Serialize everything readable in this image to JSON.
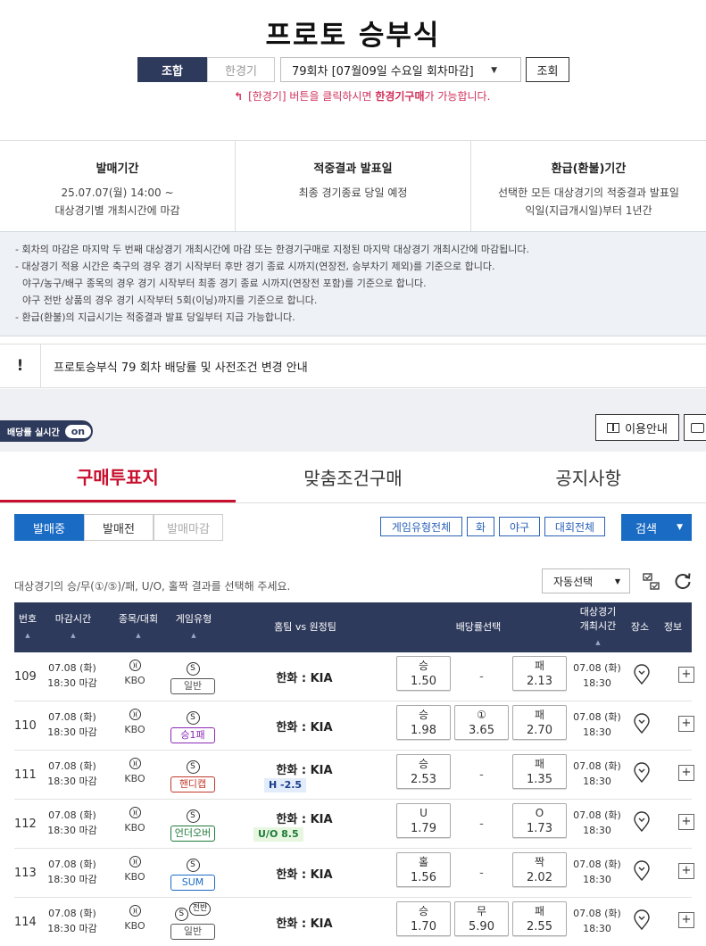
{
  "page": {
    "title": "프로토 승부식",
    "toggle_combo": "조합",
    "toggle_single": "한경기",
    "round_select": "79회차 [07월09일 수요일 회차마감]",
    "lookup": "조회",
    "notice_prefix": "[한경기] 버튼을 클릭하시면 ",
    "notice_bold": "한경기구매",
    "notice_suffix": "가 가능합니다."
  },
  "info": [
    {
      "heading": "발매기간",
      "lines": [
        "25.07.07(월) 14:00 ~",
        "대상경기별 개최시간에 마감"
      ]
    },
    {
      "heading": "적중결과 발표일",
      "lines": [
        "최종 경기종료 당일 예정"
      ]
    },
    {
      "heading": "환급(환불)기간",
      "lines": [
        "선택한 모든 대상경기의 적중결과 발표일",
        "익일(지급개시일)부터 1년간"
      ]
    }
  ],
  "notes": [
    "- 회차의 마감은 마지막 두 번째 대상경기 개최시간에 마감 또는 한경기구매로 지정된 마지막 대상경기 개최시간에 마감됩니다.",
    "- 대상경기 적용 시간은 축구의 경우 경기 시작부터 후반 경기 종료 시까지(연장전, 승부차기 제외)를 기준으로 합니다.",
    "야구/농구/배구 종목의 경우 경기 시작부터 최종 경기 종료 시까지(연장전 포함)를 기준으로 합니다.",
    "야구 전반 상품의 경우 경기 시작부터 5회(이닝)까지를 기준으로 합니다.",
    "- 환급(환불)의 지급시기는 적중결과 발표 당일부터 지급 가능합니다."
  ],
  "announce": {
    "mark": "!",
    "text": "프로토승부식 79 회차 배당률 및 사전조건 변경 안내"
  },
  "toolbar": {
    "realtime_label": "배당률 실시간",
    "realtime_state": "on",
    "guide": "이용안내"
  },
  "tabs": [
    "구매투표지",
    "맞춤조건구매",
    "공지사항"
  ],
  "status_buttons": [
    "발매중",
    "발매전",
    "발매마감"
  ],
  "filters": [
    "게임유형전체",
    "화",
    "야구",
    "대회전체"
  ],
  "search": "검색",
  "instruction": "대상경기의 승/무(①/⑤)/패, U/O, 홀짝 결과를 선택해 주세요.",
  "auto_select": "자동선택",
  "table_headers": {
    "no": "번호",
    "deadline": "마감시간",
    "sport": "종목/대회",
    "type": "게임유형",
    "match": "홈팀 vs 원정팀",
    "odds": "배당률선택",
    "event_time_1": "대상경기",
    "event_time_2": "개최시간",
    "venue": "장소",
    "info": "정보"
  },
  "colors": {
    "navy": "#2e3a5c",
    "blue": "#1a6bc4",
    "red": "#c8102e",
    "pink": "#d0305a"
  },
  "rows": [
    {
      "no": "109",
      "date": "07.08 (화)",
      "deadline": "18:30 마감",
      "league": "KBO",
      "s": "S",
      "s_extra": "",
      "type": "일반",
      "type_color": "#555555",
      "match": "한화 : KIA",
      "handicap": "",
      "h_color": "",
      "o1_label": "승",
      "o1_val": "1.50",
      "o2_label": "",
      "o2_val": "-",
      "o3_label": "패",
      "o3_val": "2.13",
      "event_date": "07.08 (화)",
      "event_time": "18:30"
    },
    {
      "no": "110",
      "date": "07.08 (화)",
      "deadline": "18:30 마감",
      "league": "KBO",
      "s": "S",
      "s_extra": "",
      "type": "승1패",
      "type_color": "#8a2bb5",
      "match": "한화 : KIA",
      "handicap": "",
      "h_color": "",
      "o1_label": "승",
      "o1_val": "1.98",
      "o2_label": "①",
      "o2_val": "3.65",
      "o3_label": "패",
      "o3_val": "2.70",
      "event_date": "07.08 (화)",
      "event_time": "18:30"
    },
    {
      "no": "111",
      "date": "07.08 (화)",
      "deadline": "18:30 마감",
      "league": "KBO",
      "s": "S",
      "s_extra": "",
      "type": "핸디캡",
      "type_color": "#c0392b",
      "match": "한화 : KIA",
      "handicap": "H -2.5",
      "h_color": "#1a3d8c",
      "o1_label": "승",
      "o1_val": "2.53",
      "o2_label": "",
      "o2_val": "-",
      "o3_label": "패",
      "o3_val": "1.35",
      "event_date": "07.08 (화)",
      "event_time": "18:30"
    },
    {
      "no": "112",
      "date": "07.08 (화)",
      "deadline": "18:30 마감",
      "league": "KBO",
      "s": "S",
      "s_extra": "",
      "type": "언더오버",
      "type_color": "#1e7a3a",
      "match": "한화 : KIA",
      "handicap": "U/O 8.5",
      "h_color": "#1e7a3a",
      "o1_label": "U",
      "o1_val": "1.79",
      "o2_label": "",
      "o2_val": "-",
      "o3_label": "O",
      "o3_val": "1.73",
      "event_date": "07.08 (화)",
      "event_time": "18:30"
    },
    {
      "no": "113",
      "date": "07.08 (화)",
      "deadline": "18:30 마감",
      "league": "KBO",
      "s": "S",
      "s_extra": "",
      "type": "SUM",
      "type_color": "#1a6bc4",
      "match": "한화 : KIA",
      "handicap": "",
      "h_color": "",
      "o1_label": "홀",
      "o1_val": "1.56",
      "o2_label": "",
      "o2_val": "-",
      "o3_label": "짝",
      "o3_val": "2.02",
      "event_date": "07.08 (화)",
      "event_time": "18:30"
    },
    {
      "no": "114",
      "date": "07.08 (화)",
      "deadline": "18:30 마감",
      "league": "KBO",
      "s": "S",
      "s_extra": "전반",
      "type": "일반",
      "type_color": "#555555",
      "match": "한화 : KIA",
      "handicap": "",
      "h_color": "",
      "o1_label": "승",
      "o1_val": "1.70",
      "o2_label": "무",
      "o2_val": "5.90",
      "o3_label": "패",
      "o3_val": "2.55",
      "event_date": "07.08 (화)",
      "event_time": "18:30"
    }
  ]
}
